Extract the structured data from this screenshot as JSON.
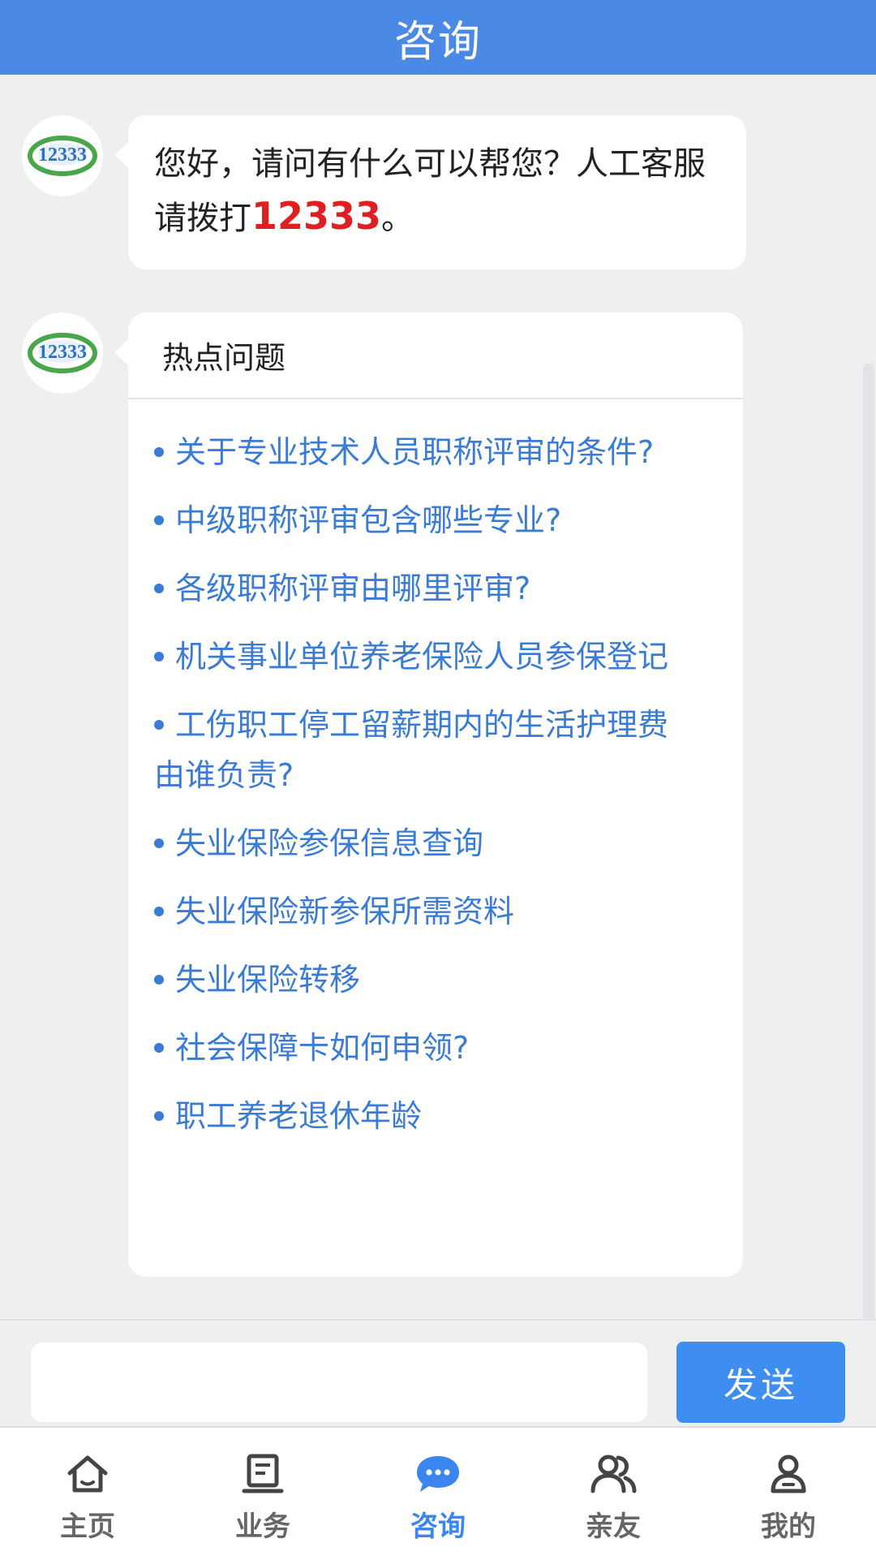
{
  "header": {
    "title": "咨询"
  },
  "chat": {
    "greeting": {
      "text_before": "您好，请问有什么可以帮您？人工客服请拨打",
      "hotline": "12333",
      "text_after": "。"
    },
    "hot_questions": {
      "title": "热点问题",
      "items": [
        "关于专业技术人员职称评审的条件?",
        "中级职称评审包含哪些专业?",
        "各级职称评审由哪里评审?",
        "机关事业单位养老保险人员参保登记",
        "工伤职工停工留薪期内的生活护理费由谁负责?",
        "失业保险参保信息查询",
        "失业保险新参保所需资料",
        "失业保险转移",
        "社会保障卡如何申领?",
        "职工养老退休年龄"
      ]
    },
    "avatar_logo_text": "12333"
  },
  "input_bar": {
    "input_value": "",
    "send_label": "发送"
  },
  "tab_bar": {
    "tabs": [
      {
        "label": "主页",
        "icon": "home-icon",
        "active": false
      },
      {
        "label": "业务",
        "icon": "document-icon",
        "active": false
      },
      {
        "label": "咨询",
        "icon": "chat-icon",
        "active": true
      },
      {
        "label": "亲友",
        "icon": "friends-icon",
        "active": false
      },
      {
        "label": "我的",
        "icon": "user-icon",
        "active": false
      }
    ]
  },
  "colors": {
    "header": "#4a89e6",
    "accent": "#3a86ee",
    "link": "#3a7cd5",
    "hotline": "#e02020",
    "background": "#eeeff1"
  }
}
